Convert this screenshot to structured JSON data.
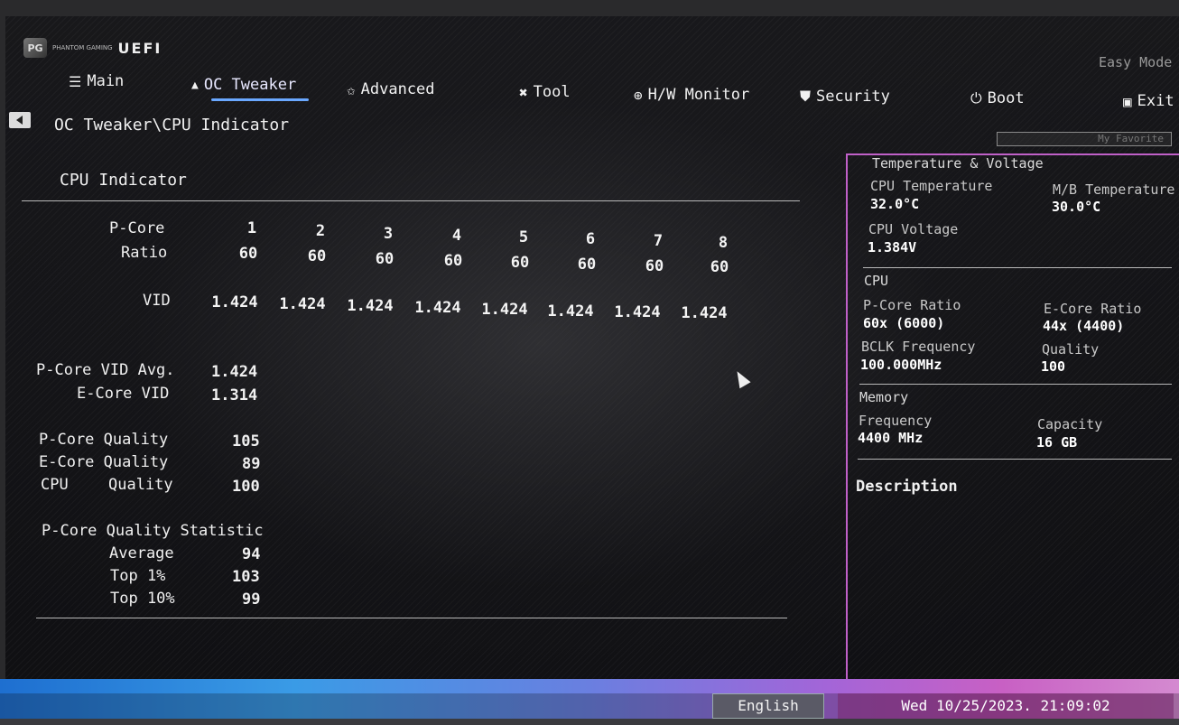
{
  "header": {
    "brand_small": "PHANTOM GAMING",
    "brand_uefi": "UEFI",
    "easy_mode": "Easy Mode"
  },
  "tabs": [
    {
      "label": "Main",
      "icon": "list-icon"
    },
    {
      "label": "OC Tweaker",
      "icon": "flame-icon",
      "active": true
    },
    {
      "label": "Advanced",
      "icon": "star-icon"
    },
    {
      "label": "Tool",
      "icon": "wrench-icon"
    },
    {
      "label": "H/W Monitor",
      "icon": "monitor-icon"
    },
    {
      "label": "Security",
      "icon": "shield-icon"
    },
    {
      "label": "Boot",
      "icon": "power-icon"
    },
    {
      "label": "Exit",
      "icon": "exit-icon"
    }
  ],
  "breadcrumb": "OC Tweaker\\CPU Indicator",
  "favorite_label": "My Favorite",
  "main": {
    "section_title": "CPU Indicator",
    "pcore_label": "P-Core",
    "ratio_label": "Ratio",
    "vid_label": "VID",
    "cores": [
      "1",
      "2",
      "3",
      "4",
      "5",
      "6",
      "7",
      "8"
    ],
    "ratios": [
      "60",
      "60",
      "60",
      "60",
      "60",
      "60",
      "60",
      "60"
    ],
    "vids": [
      "1.424",
      "1.424",
      "1.424",
      "1.424",
      "1.424",
      "1.424",
      "1.424",
      "1.424"
    ],
    "pcore_vid_avg_label": "P-Core VID Avg.",
    "pcore_vid_avg": "1.424",
    "ecore_vid_label": "E-Core VID",
    "ecore_vid": "1.314",
    "pcore_quality_label": "P-Core Quality",
    "pcore_quality": "105",
    "ecore_quality_label": "E-Core Quality",
    "ecore_quality": "89",
    "cpu_quality_label_a": "CPU",
    "cpu_quality_label_b": "Quality",
    "cpu_quality": "100",
    "stat_title": "P-Core Quality Statistic",
    "stat_average_label": "Average",
    "stat_average": "94",
    "stat_top1_label": "Top  1%",
    "stat_top1": "103",
    "stat_top10_label": "Top 10%",
    "stat_top10": "99"
  },
  "side_panel": {
    "temp_volt_title": "Temperature & Voltage",
    "cpu_temp_label": "CPU Temperature",
    "cpu_temp": "32.0°C",
    "mb_temp_label": "M/B Temperature",
    "mb_temp": "30.0°C",
    "cpu_voltage_label": "CPU Voltage",
    "cpu_voltage": "1.384V",
    "cpu_title": "CPU",
    "pcore_ratio_label": "P-Core Ratio",
    "pcore_ratio": "60x (6000)",
    "ecore_ratio_label": "E-Core Ratio",
    "ecore_ratio": "44x (4400)",
    "bclk_label": "BCLK Frequency",
    "bclk": "100.000MHz",
    "quality_label": "Quality",
    "quality": "100",
    "memory_title": "Memory",
    "mem_freq_label": "Frequency",
    "mem_freq": "4400 MHz",
    "capacity_label": "Capacity",
    "capacity": "16 GB",
    "description_label": "Description"
  },
  "footer": {
    "language": "English",
    "datetime": "Wed 10/25/2023. 21:09:02"
  },
  "colors": {
    "accent_tab_underline": "#6aa8ff",
    "panel_border": "#c060c8",
    "bottom_bar_start": "#1e6fd0",
    "bottom_bar_end": "#d48ad0"
  }
}
